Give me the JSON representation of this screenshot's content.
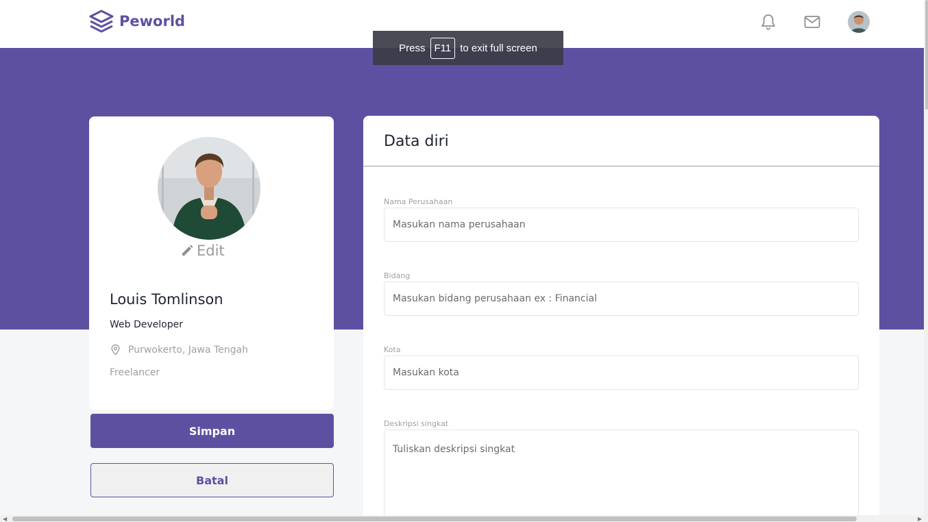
{
  "brand": {
    "name": "Peworld",
    "color": "#5e50a1",
    "logo_icon": "layers-icon"
  },
  "nav": {
    "notification_icon": "bell-icon",
    "mail_icon": "mail-icon",
    "avatar_icon": "user-avatar"
  },
  "fullscreen_toast": {
    "prefix": "Press",
    "key": "F11",
    "suffix": "to exit full screen"
  },
  "profile": {
    "edit_label": "Edit",
    "name": "Louis Tomlinson",
    "job": "Web Developer",
    "location": "Purwokerto, Jawa Tengah",
    "type": "Freelancer"
  },
  "actions": {
    "save": "Simpan",
    "cancel": "Batal"
  },
  "form": {
    "title": "Data diri",
    "fields": [
      {
        "label": "Nama Perusahaan",
        "placeholder": "Masukan nama perusahaan"
      },
      {
        "label": "Bidang",
        "placeholder": "Masukan bidang perusahaan ex : Financial"
      },
      {
        "label": "Kota",
        "placeholder": "Masukan kota"
      },
      {
        "label": "Deskripsi singkat",
        "placeholder": "Tuliskan deskripsi singkat"
      }
    ]
  }
}
